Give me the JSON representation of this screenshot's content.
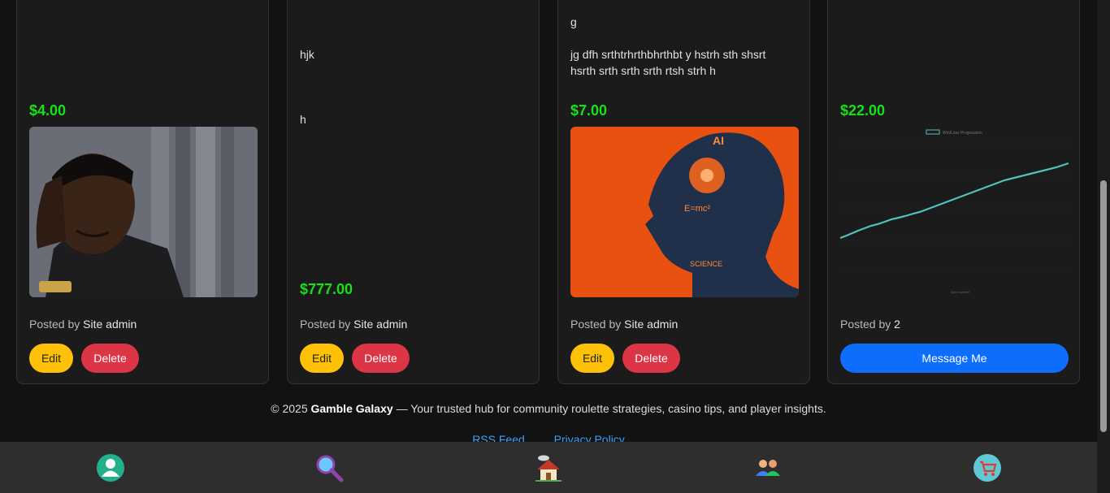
{
  "cards": [
    {
      "price": "$4.00",
      "posted_prefix": "Posted by",
      "author": "Site admin",
      "edit_label": "Edit",
      "delete_label": "Delete"
    },
    {
      "text1": "hjk",
      "text2": "h",
      "price": "$777.00",
      "posted_prefix": "Posted by",
      "author": "Site admin",
      "edit_label": "Edit",
      "delete_label": "Delete"
    },
    {
      "text1": "g",
      "text2": "jg dfh srthtrhrthbhrthbt y hstrh sth shsrt hsrth srth srth srth rtsh strh h",
      "price": "$7.00",
      "posted_prefix": "Posted by",
      "author": "Site admin",
      "edit_label": "Edit",
      "delete_label": "Delete"
    },
    {
      "price": "$22.00",
      "posted_prefix": "Posted by",
      "author": "2",
      "message_label": "Message Me",
      "chart_legend": "Win/Loss Progression",
      "chart_xlabel": "Spin Number"
    }
  ],
  "footer": {
    "copyright": "© 2025",
    "brand": "Gamble Galaxy",
    "tagline": "— Your trusted hub for community roulette strategies, casino tips, and player insights.",
    "links": [
      "RSS Feed",
      "Privacy Policy"
    ]
  },
  "nav": [
    "profile-icon",
    "search-icon",
    "home-icon",
    "community-icon",
    "cart-icon"
  ],
  "colors": {
    "price": "#18e018",
    "edit": "#ffc107",
    "delete": "#dc3545",
    "message": "#0d6efd",
    "link": "#3ba0ff"
  }
}
